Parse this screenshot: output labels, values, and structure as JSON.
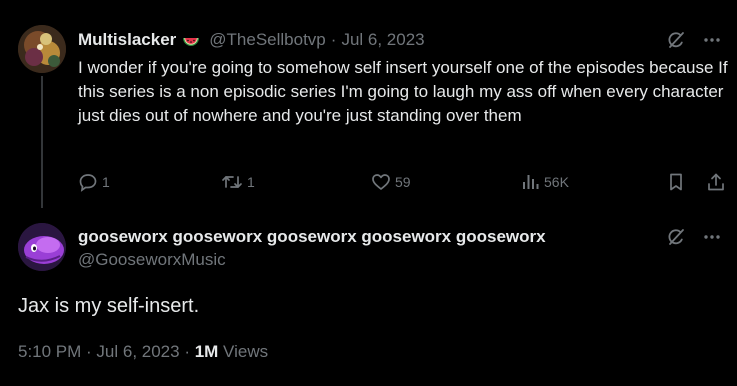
{
  "reply": {
    "author": {
      "display_name": "Multislacker",
      "emoji": "watermelon",
      "handle": "@TheSellbotvp",
      "separator": "·",
      "date": "Jul 6, 2023"
    },
    "text": "I wonder if you're going to somehow self insert yourself one of the episodes because If this series is a non episodic series I'm going to laugh my ass off when every character just dies out of nowhere and you're just standing over them",
    "actions": {
      "replies": "1",
      "reposts": "1",
      "likes": "59",
      "views": "56K"
    }
  },
  "main": {
    "author": {
      "display_name": "gooseworx gooseworx gooseworx gooseworx gooseworx",
      "handle": "@GooseworxMusic"
    },
    "text": "Jax is my self-insert.",
    "meta": {
      "time_date": "5:10 PM · Jul 6, 2023 · ",
      "views_count": "1M",
      "views_label": " Views"
    }
  },
  "icons": [
    "grok-icon",
    "more-icon",
    "reply-icon",
    "repost-icon",
    "like-icon",
    "views-icon",
    "bookmark-icon",
    "share-icon"
  ],
  "colors": {
    "background": "#000000",
    "text": "#e7e9ea",
    "secondary": "#71767b",
    "thread_line": "#333639"
  }
}
